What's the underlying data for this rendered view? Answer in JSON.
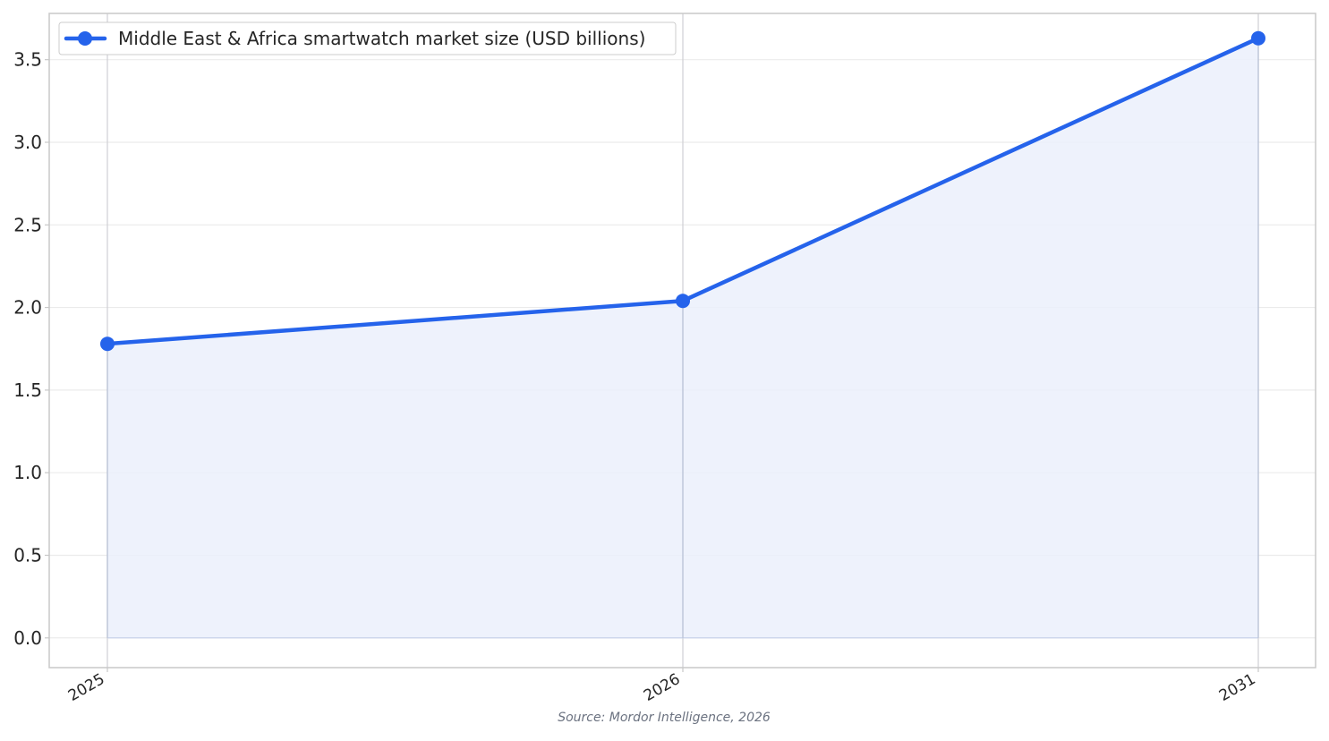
{
  "chart_data": {
    "type": "line",
    "categories": [
      "2025",
      "2026",
      "2031"
    ],
    "series": [
      {
        "name": "Middle East & Africa smartwatch market size (USD billions)",
        "values": [
          1.78,
          2.04,
          3.63
        ],
        "color": "#2563eb",
        "fill": "#ebf0fb",
        "marker": "circle"
      }
    ],
    "yticks": [
      "0.0",
      "0.5",
      "1.0",
      "1.5",
      "2.0",
      "2.5",
      "3.0",
      "3.5"
    ],
    "ylim": [
      -0.18,
      3.78
    ],
    "grid": true,
    "legend_position": "top-left",
    "area_fill": true
  },
  "source": "Source: Mordor Intelligence, 2026"
}
